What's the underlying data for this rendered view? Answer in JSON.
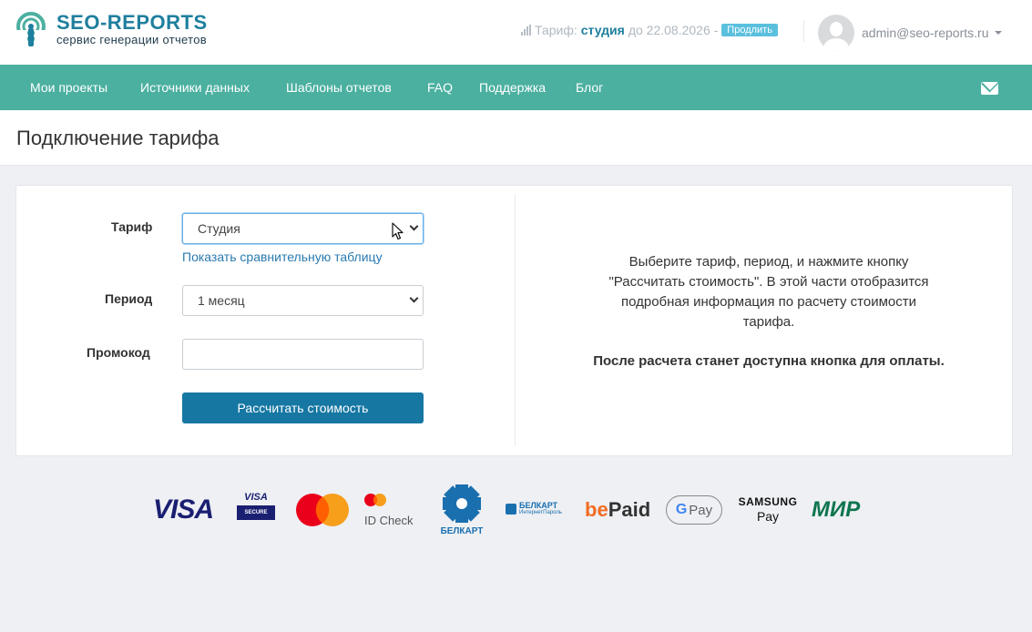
{
  "header": {
    "logo_title": "SEO-REPORTS",
    "logo_subtitle": "сервис генерации отчетов",
    "tariff_label": "Тариф:",
    "tariff_plan": "студия",
    "tariff_until": "до 22.08.2026 -",
    "extend_label": "Продлить",
    "user_email": "admin@seo-reports.ru"
  },
  "nav": {
    "items": [
      {
        "label": "Мои проекты"
      },
      {
        "label": "Источники данных"
      },
      {
        "label": "Шаблоны отчетов"
      },
      {
        "label": "FAQ"
      },
      {
        "label": "Поддержка"
      },
      {
        "label": "Блог"
      }
    ]
  },
  "page": {
    "title": "Подключение тарифа"
  },
  "form": {
    "tariff_label": "Тариф",
    "tariff_value": "Студия",
    "compare_link": "Показать сравнительную таблицу",
    "period_label": "Период",
    "period_value": "1 месяц",
    "promo_label": "Промокод",
    "promo_value": "",
    "submit_label": "Рассчитать стоимость"
  },
  "info": {
    "text": "Выберите тариф, период, и нажмите кнопку \"Рассчитать стоимость\". В этой части отобразится подробная информация по расчету стоимости тарифа.",
    "bold_text": "После расчета станет доступна кнопка для оплаты."
  },
  "payments": {
    "visa": "VISA",
    "visa_secure_top": "VISA",
    "visa_secure_bottom": "SECURE",
    "id_check": "ID Check",
    "belkart": "БЕЛКАРТ",
    "belkart_ip_top": "БЕЛКАРТ",
    "belkart_ip_bottom": "ИнтернетПароль",
    "bepaid_be": "be",
    "bepaid_paid": "Paid",
    "gpay_g": "G",
    "gpay_pay": "Pay",
    "samsung": "SAMSUNG",
    "samsung_pay": "Pay",
    "mir": "МИР"
  },
  "colors": {
    "brand": "#1f7f9e",
    "nav_bg": "#4bb0a0",
    "button": "#1677a3",
    "link": "#2a7ab0"
  }
}
